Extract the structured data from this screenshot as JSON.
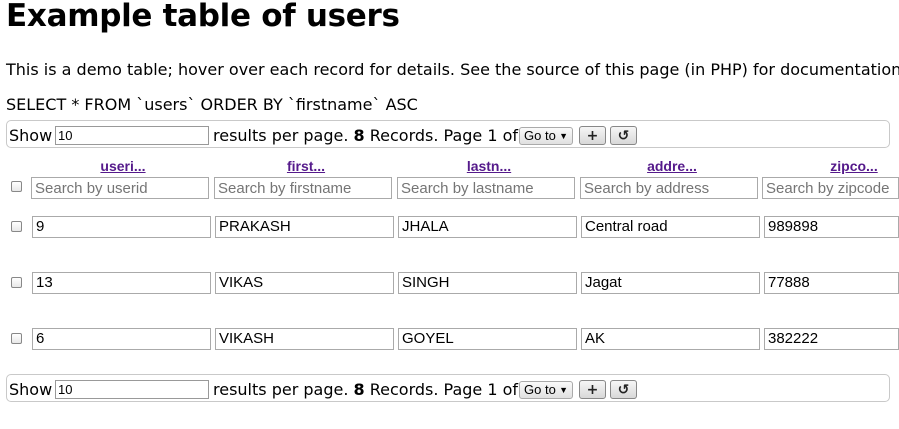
{
  "page": {
    "title": "Example table of users",
    "description": "This is a demo table; hover over each record for details. See the source of this page (in PHP) for documentation",
    "query": "SELECT * FROM `users` ORDER BY `firstname` ASC"
  },
  "pager": {
    "show_label": "Show",
    "per_page_value": "10",
    "per_page_text": "results per page.",
    "record_count": "8",
    "records_text": "Records. Page 1 of 1",
    "goto_label": "Go to",
    "add_icon": "plus-icon",
    "reset_icon": "reset-icon"
  },
  "columns": [
    {
      "label": "useri...",
      "placeholder": "Search by userid"
    },
    {
      "label": "first...",
      "placeholder": "Search by firstname"
    },
    {
      "label": "lastn...",
      "placeholder": "Search by lastname"
    },
    {
      "label": "addre...",
      "placeholder": "Search by address"
    },
    {
      "label": "zipco...",
      "placeholder": "Search by zipcode"
    }
  ],
  "rows": [
    [
      "9",
      "PRAKASH",
      "JHALA",
      "Central road",
      "989898"
    ],
    [
      "13",
      "VIKAS",
      "SINGH",
      "Jagat",
      "77888"
    ],
    [
      "6",
      "VIKASH",
      "GOYEL",
      "AK",
      "382222"
    ]
  ],
  "colors": {
    "link": "#551a8b",
    "border": "#aaaaaa"
  }
}
